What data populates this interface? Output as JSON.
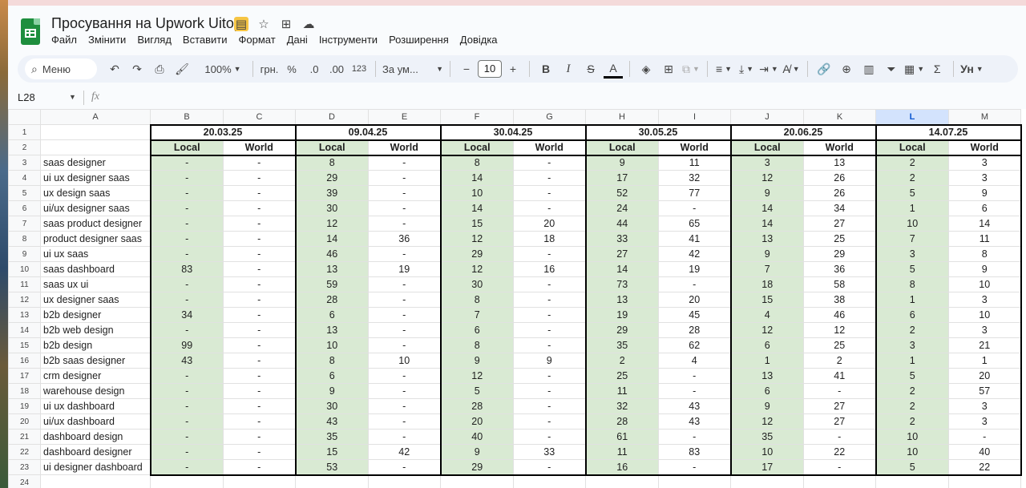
{
  "doc": {
    "title": "Просування на Upwork Uitop"
  },
  "menu": [
    "Файл",
    "Змінити",
    "Вигляд",
    "Вставити",
    "Формат",
    "Дані",
    "Інструменти",
    "Розширення",
    "Довідка"
  ],
  "toolbar": {
    "search_label": "Меню",
    "zoom": "100%",
    "currency": "грн.",
    "percent": "%",
    "dec_decrease": ".0",
    "dec_increase": ".00",
    "number_format": "123",
    "font": "За ум...",
    "font_size": "10",
    "bold": "B",
    "italic": "I",
    "strike": "S",
    "text_color": "A",
    "functions": "Σ"
  },
  "formula_bar": {
    "cell_ref": "L28",
    "fx": "fx"
  },
  "columns": [
    "A",
    "B",
    "C",
    "D",
    "E",
    "F",
    "G",
    "H",
    "I",
    "J",
    "K",
    "L",
    "M"
  ],
  "selected_column": "L",
  "dates": [
    "20.03.25",
    "09.04.25",
    "30.04.25",
    "30.05.25",
    "20.06.25",
    "14.07.25"
  ],
  "sub_headers": {
    "local": "Local",
    "world": "World"
  },
  "row_numbers": [
    "1",
    "2",
    "3",
    "4",
    "5",
    "6",
    "7",
    "8",
    "9",
    "10",
    "11",
    "12",
    "13",
    "14",
    "15",
    "16",
    "17",
    "18",
    "19",
    "20",
    "21",
    "22",
    "23",
    "24"
  ],
  "rows": [
    {
      "kw": "saas designer",
      "v": [
        "-",
        "-",
        "8",
        "-",
        "8",
        "-",
        "9",
        "11",
        "3",
        "13",
        "2",
        "3"
      ]
    },
    {
      "kw": "ui ux designer saas",
      "v": [
        "-",
        "-",
        "29",
        "-",
        "14",
        "-",
        "17",
        "32",
        "12",
        "26",
        "2",
        "3"
      ]
    },
    {
      "kw": "ux design saas",
      "v": [
        "-",
        "-",
        "39",
        "-",
        "10",
        "-",
        "52",
        "77",
        "9",
        "26",
        "5",
        "9"
      ]
    },
    {
      "kw": "ui/ux designer saas",
      "v": [
        "-",
        "-",
        "30",
        "-",
        "14",
        "-",
        "24",
        "-",
        "14",
        "34",
        "1",
        "6"
      ]
    },
    {
      "kw": "saas product designer",
      "v": [
        "-",
        "-",
        "12",
        "-",
        "15",
        "20",
        "44",
        "65",
        "14",
        "27",
        "10",
        "14"
      ]
    },
    {
      "kw": "product designer saas",
      "v": [
        "-",
        "-",
        "14",
        "36",
        "12",
        "18",
        "33",
        "41",
        "13",
        "25",
        "7",
        "11"
      ]
    },
    {
      "kw": "ui ux saas",
      "v": [
        "-",
        "-",
        "46",
        "-",
        "29",
        "-",
        "27",
        "42",
        "9",
        "29",
        "3",
        "8"
      ]
    },
    {
      "kw": "saas dashboard",
      "v": [
        "83",
        "-",
        "13",
        "19",
        "12",
        "16",
        "14",
        "19",
        "7",
        "36",
        "5",
        "9"
      ]
    },
    {
      "kw": "saas ux ui",
      "v": [
        "-",
        "-",
        "59",
        "-",
        "30",
        "-",
        "73",
        "-",
        "18",
        "58",
        "8",
        "10"
      ]
    },
    {
      "kw": "ux designer saas",
      "v": [
        "-",
        "-",
        "28",
        "-",
        "8",
        "-",
        "13",
        "20",
        "15",
        "38",
        "1",
        "3"
      ]
    },
    {
      "kw": "b2b designer",
      "v": [
        "34",
        "-",
        "6",
        "-",
        "7",
        "-",
        "19",
        "45",
        "4",
        "46",
        "6",
        "10"
      ]
    },
    {
      "kw": "b2b web design",
      "v": [
        "-",
        "-",
        "13",
        "-",
        "6",
        "-",
        "29",
        "28",
        "12",
        "12",
        "2",
        "3"
      ]
    },
    {
      "kw": "b2b design",
      "v": [
        "99",
        "-",
        "10",
        "-",
        "8",
        "-",
        "35",
        "62",
        "6",
        "25",
        "3",
        "21"
      ]
    },
    {
      "kw": "b2b saas designer",
      "v": [
        "43",
        "-",
        "8",
        "10",
        "9",
        "9",
        "2",
        "4",
        "1",
        "2",
        "1",
        "1"
      ]
    },
    {
      "kw": "crm designer",
      "v": [
        "-",
        "-",
        "6",
        "-",
        "12",
        "-",
        "25",
        "-",
        "13",
        "41",
        "5",
        "20"
      ]
    },
    {
      "kw": "warehouse design",
      "v": [
        "-",
        "-",
        "9",
        "-",
        "5",
        "-",
        "11",
        "-",
        "6",
        "-",
        "2",
        "57"
      ]
    },
    {
      "kw": "ui ux dashboard",
      "v": [
        "-",
        "-",
        "30",
        "-",
        "28",
        "-",
        "32",
        "43",
        "9",
        "27",
        "2",
        "3"
      ]
    },
    {
      "kw": "ui/ux dashboard",
      "v": [
        "-",
        "-",
        "43",
        "-",
        "20",
        "-",
        "28",
        "43",
        "12",
        "27",
        "2",
        "3"
      ]
    },
    {
      "kw": "dashboard design",
      "v": [
        "-",
        "-",
        "35",
        "-",
        "40",
        "-",
        "61",
        "-",
        "35",
        "-",
        "10",
        "-"
      ]
    },
    {
      "kw": "dashboard designer",
      "v": [
        "-",
        "-",
        "15",
        "42",
        "9",
        "33",
        "11",
        "83",
        "10",
        "22",
        "10",
        "40"
      ]
    },
    {
      "kw": "ui designer dashboard",
      "v": [
        "-",
        "-",
        "53",
        "-",
        "29",
        "-",
        "16",
        "-",
        "17",
        "-",
        "5",
        "22"
      ]
    }
  ]
}
